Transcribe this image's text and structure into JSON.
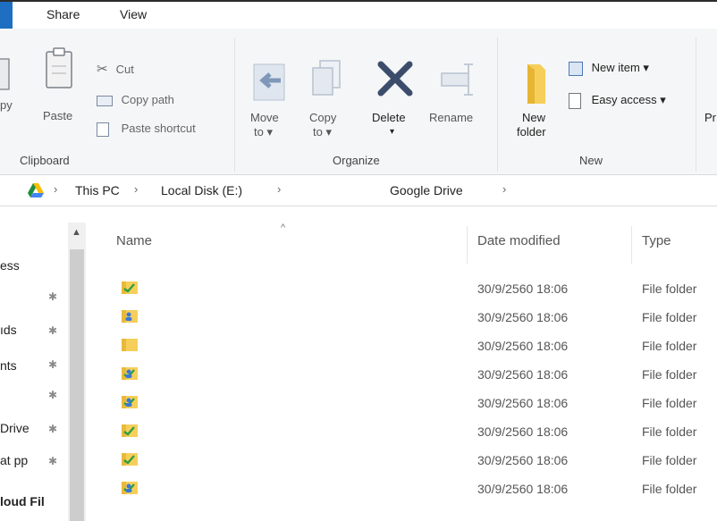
{
  "tabs": {
    "file": "",
    "share": "Share",
    "view": "View"
  },
  "ribbon": {
    "clipboard": {
      "copy_partial": "py",
      "paste": "Paste",
      "cut": "Cut",
      "copy_path": "Copy path",
      "paste_shortcut": "Paste shortcut",
      "group_label": "Clipboard"
    },
    "organize": {
      "move_to_line1": "Move",
      "move_to_line2": "to ▾",
      "copy_to_line1": "Copy",
      "copy_to_line2": "to ▾",
      "delete": "Delete",
      "delete_caret": "▾",
      "rename": "Rename",
      "group_label": "Organize"
    },
    "new": {
      "new_folder_line1": "New",
      "new_folder_line2": "folder",
      "new_item": "New item ▾",
      "easy_access": "Easy access ▾",
      "group_label": "New"
    },
    "open_partial": "Pr"
  },
  "address": {
    "sep": "›",
    "crumbs": [
      "This PC",
      "Local Disk (E:)",
      "Google Drive"
    ]
  },
  "nav": {
    "items": [
      {
        "label": "ess",
        "pinned": false
      },
      {
        "label": "",
        "pinned": true
      },
      {
        "label": "ıds",
        "pinned": true
      },
      {
        "label": "nts",
        "pinned": true
      },
      {
        "label": "",
        "pinned": true
      },
      {
        "label": "Drive",
        "pinned": true
      },
      {
        "label": "at pp",
        "pinned": true
      },
      {
        "label": "loud Fil",
        "pinned": false
      }
    ],
    "pin_glyph": "📌"
  },
  "list": {
    "headers": {
      "name": "Name",
      "date": "Date modified",
      "type": "Type",
      "sort_caret": "^"
    },
    "rows": [
      {
        "icon": "synced-folder-icon",
        "date": "30/9/2560 18:06",
        "type": "File folder"
      },
      {
        "icon": "shared-folder-icon",
        "date": "30/9/2560 18:06",
        "type": "File folder"
      },
      {
        "icon": "folder-icon",
        "date": "30/9/2560 18:06",
        "type": "File folder"
      },
      {
        "icon": "shared-synced-folder-icon",
        "date": "30/9/2560 18:06",
        "type": "File folder"
      },
      {
        "icon": "shared-synced-folder-icon",
        "date": "30/9/2560 18:06",
        "type": "File folder"
      },
      {
        "icon": "synced-folder-icon",
        "date": "30/9/2560 18:06",
        "type": "File folder"
      },
      {
        "icon": "synced-folder-icon",
        "date": "30/9/2560 18:06",
        "type": "File folder"
      },
      {
        "icon": "shared-synced-folder-icon",
        "date": "30/9/2560 18:06",
        "type": "File folder"
      }
    ]
  },
  "colors": {
    "accent": "#1e6fc1",
    "folder": "#f6cf5a",
    "sync_check": "#2ea043",
    "shared": "#3a78d6"
  }
}
